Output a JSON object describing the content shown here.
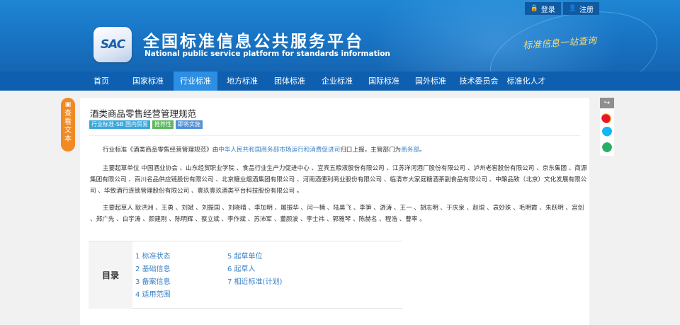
{
  "header": {
    "login_label": "登录",
    "register_label": "注册",
    "logo_text": "SAC",
    "site_title": "全国标准信息公共服务平台",
    "site_subtitle": "National public service platform  for standards information",
    "slogan": "标准信息一站查询"
  },
  "nav": {
    "items": [
      "首页",
      "国家标准",
      "行业标准",
      "地方标准",
      "团体标准",
      "企业标准",
      "国际标准",
      "国外标准",
      "技术委员会",
      "标准化人才"
    ],
    "active_index": 2
  },
  "side_tab": {
    "chars": [
      "查",
      "看",
      "文",
      "本"
    ]
  },
  "standard": {
    "title": "酒类商品零售经营管理规范",
    "tags": [
      {
        "label": "行业标准-SB 国内贸易",
        "color": "#3aa6d8"
      },
      {
        "label": "推荐性",
        "color": "#5cb85c"
      },
      {
        "label": "即将实施",
        "color": "#4f8fd6"
      }
    ]
  },
  "intro": {
    "p1_a": "行业标准《酒类商品零售经营管理规范》由",
    "p1_link1": "中华人民共和国商务部市场运行和消费促进司",
    "p1_b": "归口上报，主管部门为",
    "p1_link2": "商务部",
    "p1_c": "。",
    "p2": "主要起草单位 中国酒业协会 、山东经贸职业学院 、食品行业生产力促进中心 、宜宾五粮液股份有限公司 、江苏洋河酒厂股份有限公司 、泸州老窖股份有限公司 、京东集团 、商源集团有限公司 、百川名品供应链股份有限公司 、北京糖业烟酒集团有限公司 、河南酒便利商业股份有限公司 、临清市大家庭糖酒茶副食品有限公司 、中酿品致（北京）文化发展有限公司 、华致酒行连锁管理股份有限公司 、壹玖壹玖酒类平台科技股份有限公司 。",
    "p3": "主要起草人 耿洪洲 、王勇 、刘斌 、刘振国 、刘晓晴 、李加明 、屠振华 、闫一楠 、陆昊飞 、李笋 、游涛 、王一 、胡志明 、于庆泉 、赵焜 、袁妙珠 、毛明霞 、朱跃明 、宫剑 、郑广先 、白宇涛 、颜建刚 、陈明辉 、蔡立斌 、李作斌 、苏沛军 、董颜波 、李士祎 、郭雅琴 、陈赫名 、程浩 、曹率 。"
  },
  "toc": {
    "title": "目录",
    "items": [
      "1  标准状态",
      "2  基础信息",
      "3  备案信息",
      "4  适用范围",
      "5  起草单位",
      "6  起草人",
      "7  相近标准(计划)"
    ]
  },
  "colors": {
    "brand_blue": "#1873c3",
    "nav_blue": "#0f5fb0",
    "nav_active": "#2c8fe3",
    "side_tab_orange": "#f08a24",
    "link_blue": "#3a80c6"
  },
  "share_icons": [
    "share-icon",
    "weibo-icon",
    "qq-icon",
    "wechat-icon"
  ]
}
